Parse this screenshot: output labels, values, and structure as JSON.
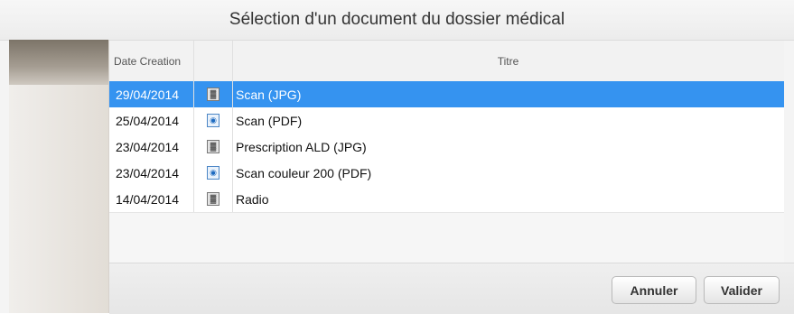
{
  "dialog": {
    "title": "Sélection d'un document du dossier médical"
  },
  "table": {
    "columns": {
      "date": "Date Creation",
      "title": "Titre"
    },
    "rows": [
      {
        "date": "29/04/2014",
        "icon": "image-document-icon",
        "title": "Scan (JPG)",
        "selected": true
      },
      {
        "date": "25/04/2014",
        "icon": "pdf-document-icon",
        "title": "Scan (PDF)",
        "selected": false
      },
      {
        "date": "23/04/2014",
        "icon": "image-document-icon",
        "title": "Prescription ALD (JPG)",
        "selected": false
      },
      {
        "date": "23/04/2014",
        "icon": "pdf-document-icon",
        "title": "Scan couleur 200 (PDF)",
        "selected": false
      },
      {
        "date": "14/04/2014",
        "icon": "image-document-icon",
        "title": "Radio",
        "selected": false
      }
    ]
  },
  "buttons": {
    "cancel": "Annuler",
    "validate": "Valider"
  },
  "colors": {
    "selection": "#3593f0"
  }
}
